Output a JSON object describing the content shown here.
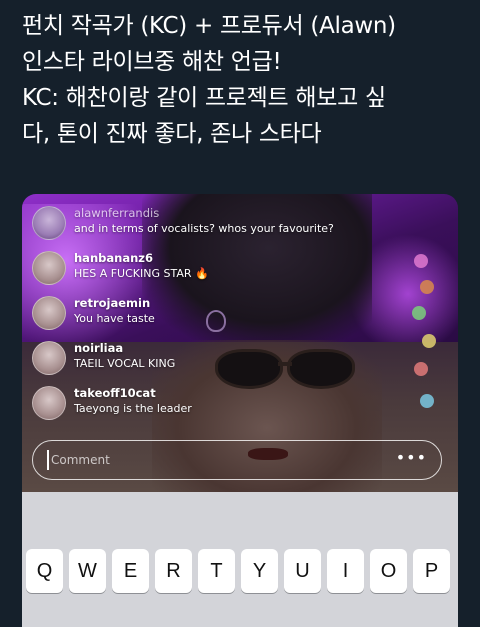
{
  "tweet": {
    "lines": [
      "펀치 작곡가 (KC) + 프로듀서 (Alawn)",
      "인스타 라이브중 해찬 언급!",
      "KC: 해찬이랑 같이 프로젝트 해보고 싶",
      "다, 톤이 진짜 좋다, 존나 스타다"
    ]
  },
  "live": {
    "comments": [
      {
        "user": "alawnferrandis",
        "message": "and in terms of vocalists? whos your favourite?"
      },
      {
        "user": "hanbananz6",
        "message": "HES A FUCKING STAR 🔥"
      },
      {
        "user": "retrojaemin",
        "message": "You have taste"
      },
      {
        "user": "noirliaa",
        "message": "TAEIL VOCAL KING"
      },
      {
        "user": "takeoff10cat",
        "message": "Taeyong is the leader"
      }
    ],
    "comment_input": {
      "placeholder": "Comment",
      "more_icon": "•••"
    }
  },
  "keyboard": {
    "row1": [
      "Q",
      "W",
      "E",
      "R",
      "T",
      "Y",
      "U",
      "I",
      "O",
      "P"
    ]
  },
  "colors": {
    "background": "#15202b",
    "text": "#ffffff",
    "live_purple": "#8f2fc9",
    "keyboard_bg": "#d3d4d9"
  }
}
